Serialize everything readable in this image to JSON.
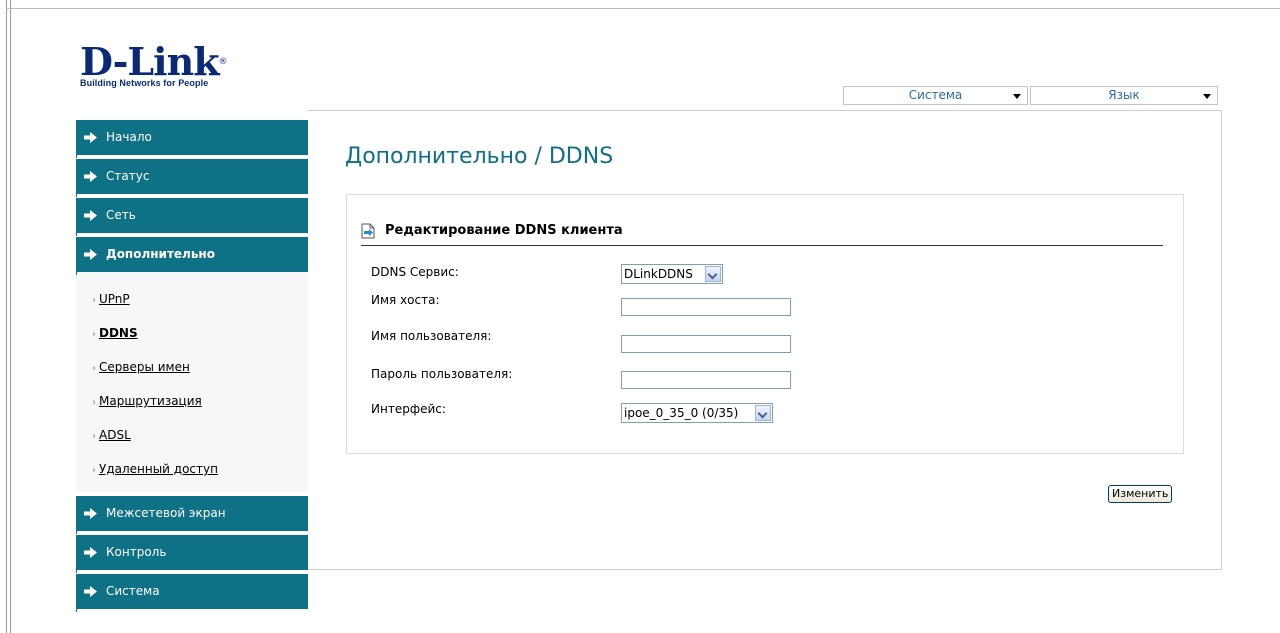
{
  "logo": {
    "name": "D-Link",
    "tagline": "Building Networks for People"
  },
  "topbar": {
    "system_select": "Система",
    "language_select": "Язык"
  },
  "sidebar": {
    "items": [
      {
        "label": "Начало"
      },
      {
        "label": "Статус"
      },
      {
        "label": "Сеть"
      },
      {
        "label": "Дополнительно",
        "active": true
      }
    ],
    "subitems": [
      {
        "label": "UPnP"
      },
      {
        "label": "DDNS",
        "active": true
      },
      {
        "label": "Серверы имен"
      },
      {
        "label": "Маршрутизация"
      },
      {
        "label": "ADSL"
      },
      {
        "label": "Удаленный доступ"
      }
    ],
    "items_after": [
      {
        "label": "Межсетевой экран"
      },
      {
        "label": "Контроль"
      },
      {
        "label": "Система"
      }
    ]
  },
  "main": {
    "title": "Дополнительно /  DDNS",
    "section_title": "Редактирование DDNS клиента",
    "fields": {
      "ddns_service": {
        "label": "DDNS Сервис:",
        "value": "DLinkDDNS"
      },
      "hostname": {
        "label": "Имя хоста:",
        "value": ""
      },
      "username": {
        "label": "Имя пользователя:",
        "value": ""
      },
      "password": {
        "label": "Пароль пользователя:",
        "value": ""
      },
      "interface": {
        "label": "Интерфейс:",
        "value": "ipoe_0_35_0 (0/35)"
      }
    },
    "apply_label": "Изменить"
  },
  "colors": {
    "menu_bg": "#0e7186",
    "title": "#0e6f86",
    "logo": "#0a2a78"
  }
}
